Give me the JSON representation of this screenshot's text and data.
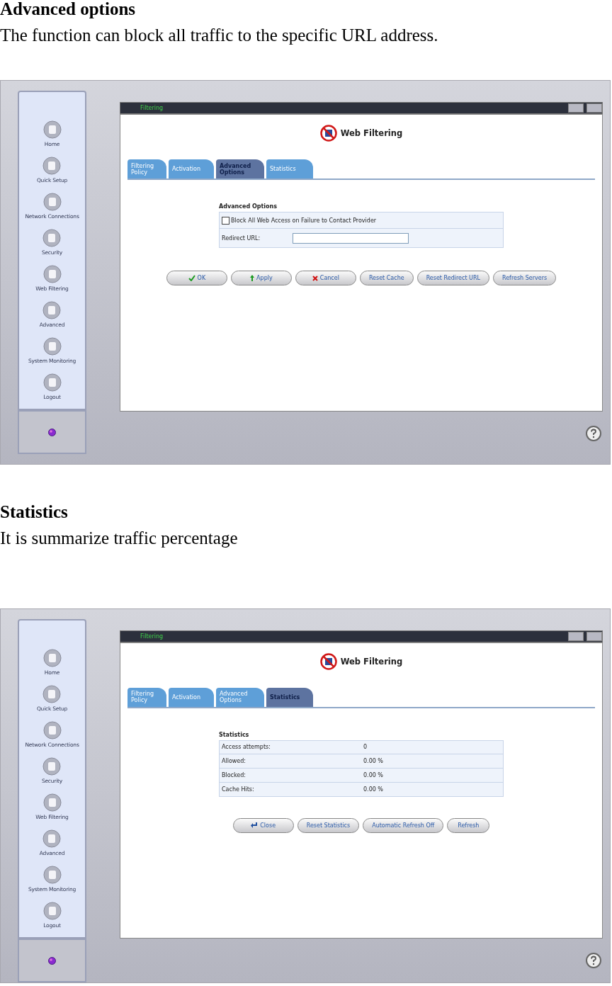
{
  "sections": [
    {
      "heading": "Advanced options",
      "description": "The function can block all traffic to the specific URL address.",
      "screen": {
        "title_bar": "Filtering",
        "sidebar": [
          "Home",
          "Quick Setup",
          "Network Connections",
          "Security",
          "Web Filtering",
          "Advanced",
          "System Monitoring",
          "Logout"
        ],
        "page_title": "Web Filtering",
        "tabs": [
          {
            "label": "Filtering Policy",
            "selected": false
          },
          {
            "label": "Activation",
            "selected": false
          },
          {
            "label": "Advanced Options",
            "selected": true
          },
          {
            "label": "Statistics",
            "selected": false
          }
        ],
        "panel": {
          "title": "Advanced Options",
          "rows": [
            {
              "kind": "checkbox",
              "label": "Block All Web Access on Failure to Contact Provider",
              "checked": false
            },
            {
              "kind": "field",
              "label": "Redirect URL:"
            }
          ]
        },
        "buttons": [
          {
            "kind": "ok",
            "label": "OK"
          },
          {
            "kind": "apply",
            "label": "Apply"
          },
          {
            "kind": "cancel",
            "label": "Cancel"
          },
          {
            "kind": "plain",
            "label": "Reset Cache"
          },
          {
            "kind": "plain",
            "label": "Reset Redirect URL"
          },
          {
            "kind": "plain",
            "label": "Refresh Servers"
          }
        ]
      }
    },
    {
      "heading": "Statistics",
      "description": "It is summarize traffic percentage",
      "screen": {
        "title_bar": "Filtering",
        "sidebar": [
          "Home",
          "Quick Setup",
          "Network Connections",
          "Security",
          "Web Filtering",
          "Advanced",
          "System Monitoring",
          "Logout"
        ],
        "page_title": "Web Filtering",
        "tabs": [
          {
            "label": "Filtering Policy",
            "selected": false
          },
          {
            "label": "Activation",
            "selected": false
          },
          {
            "label": "Advanced Options",
            "selected": false
          },
          {
            "label": "Statistics",
            "selected": true
          }
        ],
        "panel": {
          "title": "Statistics",
          "rows": [
            {
              "kind": "stat",
              "label": "Access attempts:",
              "value": "0"
            },
            {
              "kind": "stat",
              "label": "Allowed:",
              "value": "0.00 %"
            },
            {
              "kind": "stat",
              "label": "Blocked:",
              "value": "0.00 %"
            },
            {
              "kind": "stat",
              "label": "Cache Hits:",
              "value": "0.00 %"
            }
          ]
        },
        "buttons": [
          {
            "kind": "close",
            "label": "Close"
          },
          {
            "kind": "plain",
            "label": "Reset Statistics"
          },
          {
            "kind": "plain",
            "label": "Automatic Refresh Off"
          },
          {
            "kind": "plain",
            "label": "Refresh"
          }
        ]
      }
    }
  ]
}
